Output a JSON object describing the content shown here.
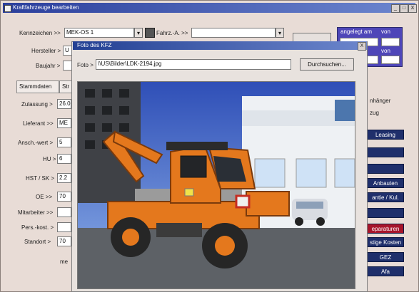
{
  "window": {
    "title": "Kraftfahrzeuge bearbeiten",
    "minimize": "_",
    "maximize": "□",
    "close": "X"
  },
  "header": {
    "kennzeichen_label": "Kennzeichen >>",
    "kennzeichen_value": "MEK-OS 1",
    "fahrz_label": "Fahrz.-A. >>",
    "fahrz_value": "",
    "angelegt_label": "angelegt am",
    "von_label": "von",
    "von2_label": "von"
  },
  "form": {
    "hersteller": "Hersteller >",
    "hersteller_value": "U",
    "baujahr": "Baujahr >",
    "baujahr_value": "",
    "zulassung": "Zulassung >",
    "zulassung_value": "26.0",
    "lieferant": "Lieferant >>",
    "lieferant_value": "ME",
    "ansch_wert": "Ansch.-wert >",
    "ansch_wert_value": "5",
    "hu": "HU >",
    "hu_value": "6",
    "hst_sk": "HST / SK >",
    "hst_sk_value": "2.2",
    "oe": "OE >>",
    "oe_value": "70",
    "mitarbeiter": "Mitarbeiter >>",
    "mitarbeiter_value": "",
    "pers_kost": "Pers.-kost. >",
    "pers_kost_value": "",
    "standort": "Standort >",
    "standort_value": "70",
    "me_text": "me"
  },
  "tabs": {
    "stammdaten": "Stammdaten",
    "second": "Str"
  },
  "right": {
    "anhaenger": "nhänger",
    "zug": "zug",
    "leasing": "Leasing",
    "anbauten": "Anbauten",
    "garantie": "antie / Kul.",
    "reparaturen": "eparaturen",
    "sonstige": "stige Kosten",
    "gez": "GEZ",
    "afa": "Afa"
  },
  "dialog": {
    "title": "Foto des KFZ",
    "close": "X",
    "foto_label": "Foto >",
    "foto_path": "\\\\US\\Bilder\\LDK-2194.jpg",
    "browse": "Durchsuchen..."
  },
  "colors": {
    "titlebar": "#2b3f9c",
    "panel_blue": "#4e46b8",
    "navy_button": "#1f2f6b",
    "red_button": "#a7152b",
    "truck_orange": "#e4781d"
  }
}
